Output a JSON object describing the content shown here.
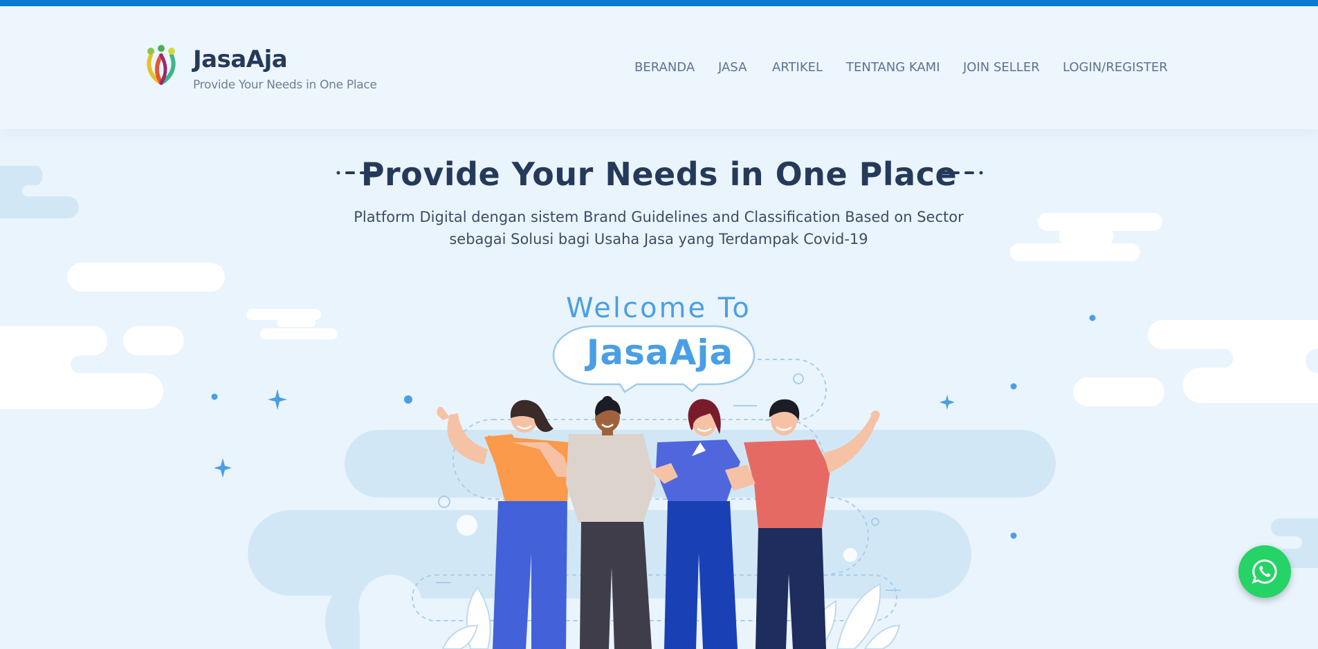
{
  "header": {
    "brand_name": "JasaAja",
    "tagline": "Provide Your Needs in One Place",
    "nav": [
      {
        "label": "BERANDA"
      },
      {
        "label": "JASA"
      },
      {
        "label": "ARTIKEL"
      },
      {
        "label": "TENTANG KAMI"
      },
      {
        "label": "JOIN SELLER"
      },
      {
        "label": "LOGIN/REGISTER"
      }
    ]
  },
  "hero": {
    "title": "Provide Your Needs in One Place",
    "subtitle_line1": "Platform Digital dengan sistem Brand Guidelines and Classification Based on Sector",
    "subtitle_line2": "sebagai Solusi bagi Usaha Jasa yang Terdampak Covid-19",
    "welcome_text": "Welcome To",
    "welcome_brand": "JasaAja"
  },
  "floating": {
    "whatsapp_icon": "whatsapp-icon"
  },
  "colors": {
    "accent_bar": "#0a7bd5",
    "heading": "#253a5a",
    "nav_text": "#5c7294",
    "background": "#eaf4fd",
    "cloud_blue": "#d2e7f6",
    "welcome_blue": "#4a9fe4",
    "whatsapp_green": "#25d366"
  },
  "illustration_icon": "four-people-waving-illustration"
}
